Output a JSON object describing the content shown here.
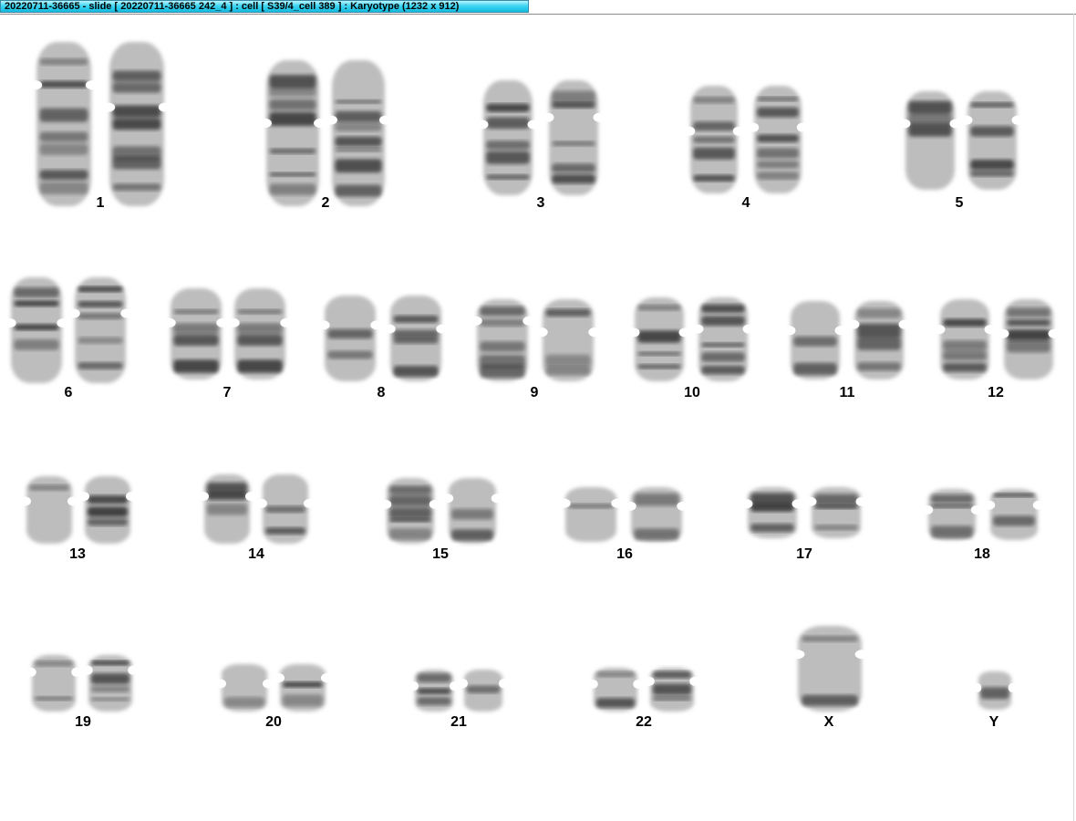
{
  "window": {
    "title": "20220711-36665 - slide [ 20220711-36665 242_4 ] : cell [ S39/4_cell 389 ] : Karyotype  (1232 x 912)"
  },
  "karyotype": {
    "chromosome_labels": [
      "1",
      "2",
      "3",
      "4",
      "5",
      "6",
      "7",
      "8",
      "9",
      "10",
      "11",
      "12",
      "13",
      "14",
      "15",
      "16",
      "17",
      "18",
      "19",
      "20",
      "21",
      "22",
      "X",
      "Y"
    ]
  },
  "colors": {
    "titlebar_accent": "#2fcbed",
    "chromosome_dark": "#2a2a2a",
    "chromosome_light": "#bdbdbd"
  }
}
